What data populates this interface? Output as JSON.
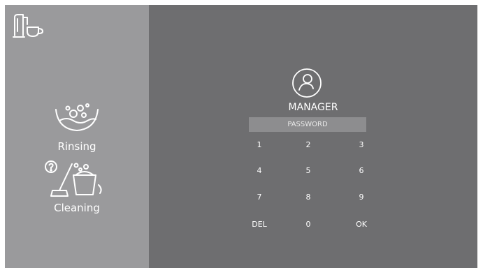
{
  "sidebar": {
    "logo_icon": "coffee-machine-icon",
    "items": [
      {
        "label": "Rinsing",
        "icon": "rinsing-icon"
      },
      {
        "label": "Cleaning",
        "icon": "cleaning-icon"
      }
    ]
  },
  "login": {
    "user_icon": "user-avatar-icon",
    "user_name": "MANAGER",
    "password_placeholder": "PASSWORD"
  },
  "keypad": {
    "keys": [
      "1",
      "2",
      "3",
      "4",
      "5",
      "6",
      "7",
      "8",
      "9",
      "DEL",
      "0",
      "OK"
    ]
  },
  "colors": {
    "sidebar_bg": "#9a9a9c",
    "main_bg": "#6e6e70",
    "field_bg": "#8d8d8f",
    "text": "#ffffff"
  }
}
